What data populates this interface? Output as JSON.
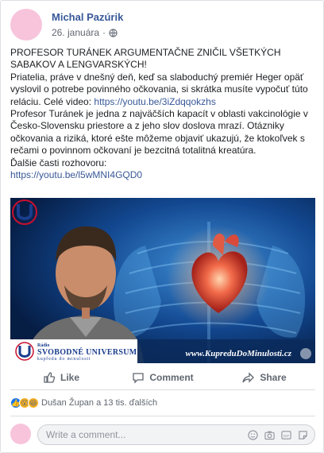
{
  "post": {
    "author": "Michal Pazúrik",
    "date": "26. januára",
    "dot": "·",
    "text": {
      "line1": "PROFESOR TURÁNEK ARGUMENTAČNE ZNIČIL VŠETKÝCH SABAKOV A LENGVARSKÝCH!",
      "line2": "Priatelia, práve v dnešný deň, keď sa slaboduchý premiér Heger opäť vyslovil o potrebe povinného očkovania, si skrátka musíte vypočuť túto reláciu. Celé video: ",
      "link1": "https://youtu.be/3iZdqqokzhs",
      "line3": "Profesor Turánek je jedna z najväčších kapacít v oblasti vakcinológie v Česko-Slovensku priestore a z jeho slov doslova mrazí. Otázniky očkovania a riziká, ktoré ešte môžeme objaviť ukazujú, že ktokoľvek s rečami o povinnom očkovaní je bezcitná totalitná kreatúra.",
      "line4": "Ďalšie časti rozhovoru:",
      "link2": "https://youtu.be/l5wMNI4GQD0"
    }
  },
  "media": {
    "brand_small": "Rádio",
    "brand_name": "SVOBODNÉ UNIVERSUM",
    "brand_tagline": "kupředu do minulosti",
    "site_url": "www.KupreduDoMinulosti.cz"
  },
  "actions": {
    "like": "Like",
    "comment": "Comment",
    "share": "Share"
  },
  "reactions": {
    "summary": "Dušan Župan a 13 tis. ďalších"
  },
  "comment_box": {
    "placeholder": "Write a comment..."
  },
  "colors": {
    "link": "#385898",
    "avatar": "#f7c4dc"
  }
}
